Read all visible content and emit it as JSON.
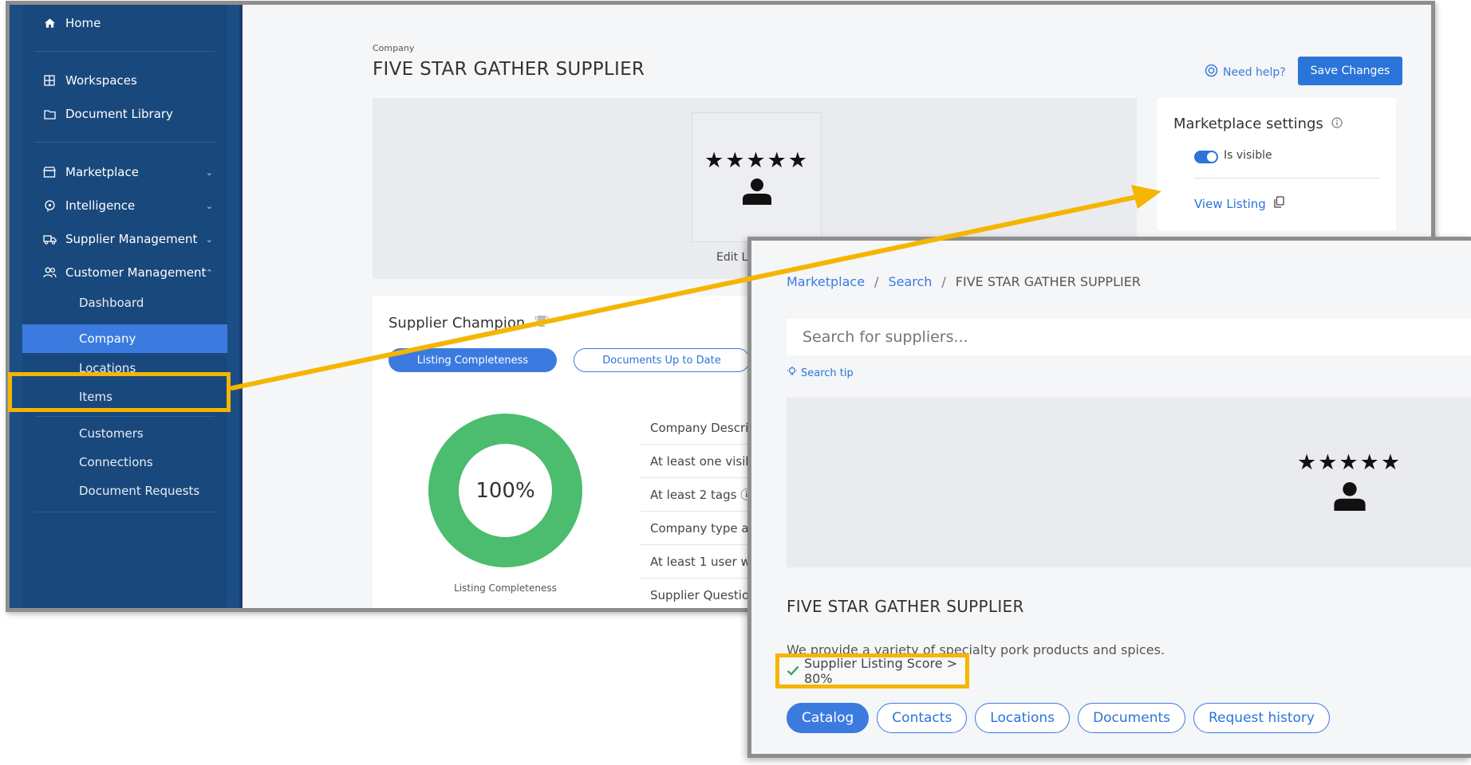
{
  "sidebar": {
    "items": [
      {
        "label": "Home",
        "icon": "home-icon"
      },
      {
        "label": "Workspaces",
        "icon": "grid-icon"
      },
      {
        "label": "Document Library",
        "icon": "folder-icon"
      },
      {
        "label": "Marketplace",
        "icon": "store-icon"
      },
      {
        "label": "Intelligence",
        "icon": "brain-icon"
      },
      {
        "label": "Supplier Management",
        "icon": "truck-icon"
      },
      {
        "label": "Customer Management",
        "icon": "users-icon"
      }
    ],
    "subitems": [
      "Dashboard",
      "Company",
      "Locations",
      "Items",
      "Customers",
      "Connections",
      "Document Requests"
    ]
  },
  "page": {
    "kicker": "Company",
    "title": "FIVE STAR GATHER SUPPLIER",
    "help_link": "Need help?",
    "save_button": "Save Changes",
    "edit_logo": "Edit L"
  },
  "settings": {
    "title": "Marketplace settings",
    "toggle_label": "Is visible",
    "toggle_on": true,
    "view_listing": "View Listing"
  },
  "champion": {
    "title": "Supplier Champion",
    "tabs": [
      "Listing Completeness",
      "Documents Up to Date"
    ],
    "donut_value": "100%",
    "donut_caption": "Listing Completeness",
    "checklist": [
      "Company Descri",
      "At least one visib",
      "At least 2 tags ⓘ",
      "Company type a",
      "At least 1 user wit",
      "Supplier Questio"
    ]
  },
  "listing": {
    "breadcrumbs": [
      "Marketplace",
      "Search",
      "FIVE STAR GATHER SUPPLIER"
    ],
    "search_placeholder": "Search for suppliers...",
    "search_tip": "Search tip",
    "name": "FIVE STAR GATHER SUPPLIER",
    "description": "We provide a variety of specialty pork products and spices.",
    "score_badge": "Supplier Listing Score > 80%",
    "tabs": [
      "Catalog",
      "Contacts",
      "Locations",
      "Documents",
      "Request history"
    ]
  },
  "logo_stars": "★★★★★",
  "colors": {
    "sidebar": "#19487d",
    "accent": "#3b7be0",
    "highlight": "#f5b500",
    "donut": "#4cbc6e"
  }
}
